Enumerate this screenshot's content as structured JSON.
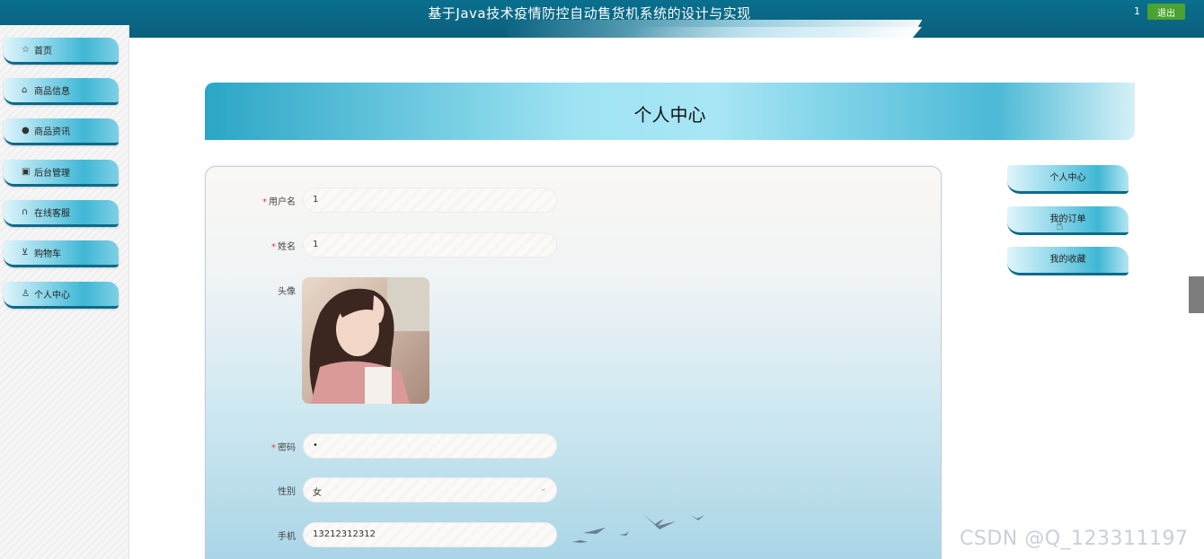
{
  "header": {
    "title": "基于Java技术疫情防控自动售货机系统的设计与实现",
    "user": "1",
    "logout_label": "退出"
  },
  "sidebar": {
    "items": [
      {
        "label": "首页",
        "icon": "star-icon"
      },
      {
        "label": "商品信息",
        "icon": "bag-icon"
      },
      {
        "label": "商品资讯",
        "icon": "info-icon"
      },
      {
        "label": "后台管理",
        "icon": "briefcase-icon"
      },
      {
        "label": "在线客服",
        "icon": "headset-icon"
      },
      {
        "label": "购物车",
        "icon": "cart-icon"
      },
      {
        "label": "个人中心",
        "icon": "user-icon"
      }
    ]
  },
  "main": {
    "banner_title": "个人中心",
    "form": {
      "username_label": "用户名",
      "username_value": "1",
      "name_label": "姓名",
      "name_value": "1",
      "avatar_label": "头像",
      "password_label": "密码",
      "password_value": "•",
      "gender_label": "性别",
      "gender_value": "女",
      "phone_label": "手机",
      "phone_value": "13212312312"
    }
  },
  "right_tabs": [
    {
      "label": "个人中心"
    },
    {
      "label": "我的订单"
    },
    {
      "label": "我的收藏"
    }
  ],
  "watermark": "CSDN @Q_123311197",
  "colors": {
    "header_bg": "#0b5f7c",
    "logout_bg": "#4aa32e",
    "accent": "#3fb7d5",
    "required": "#ee3333"
  }
}
